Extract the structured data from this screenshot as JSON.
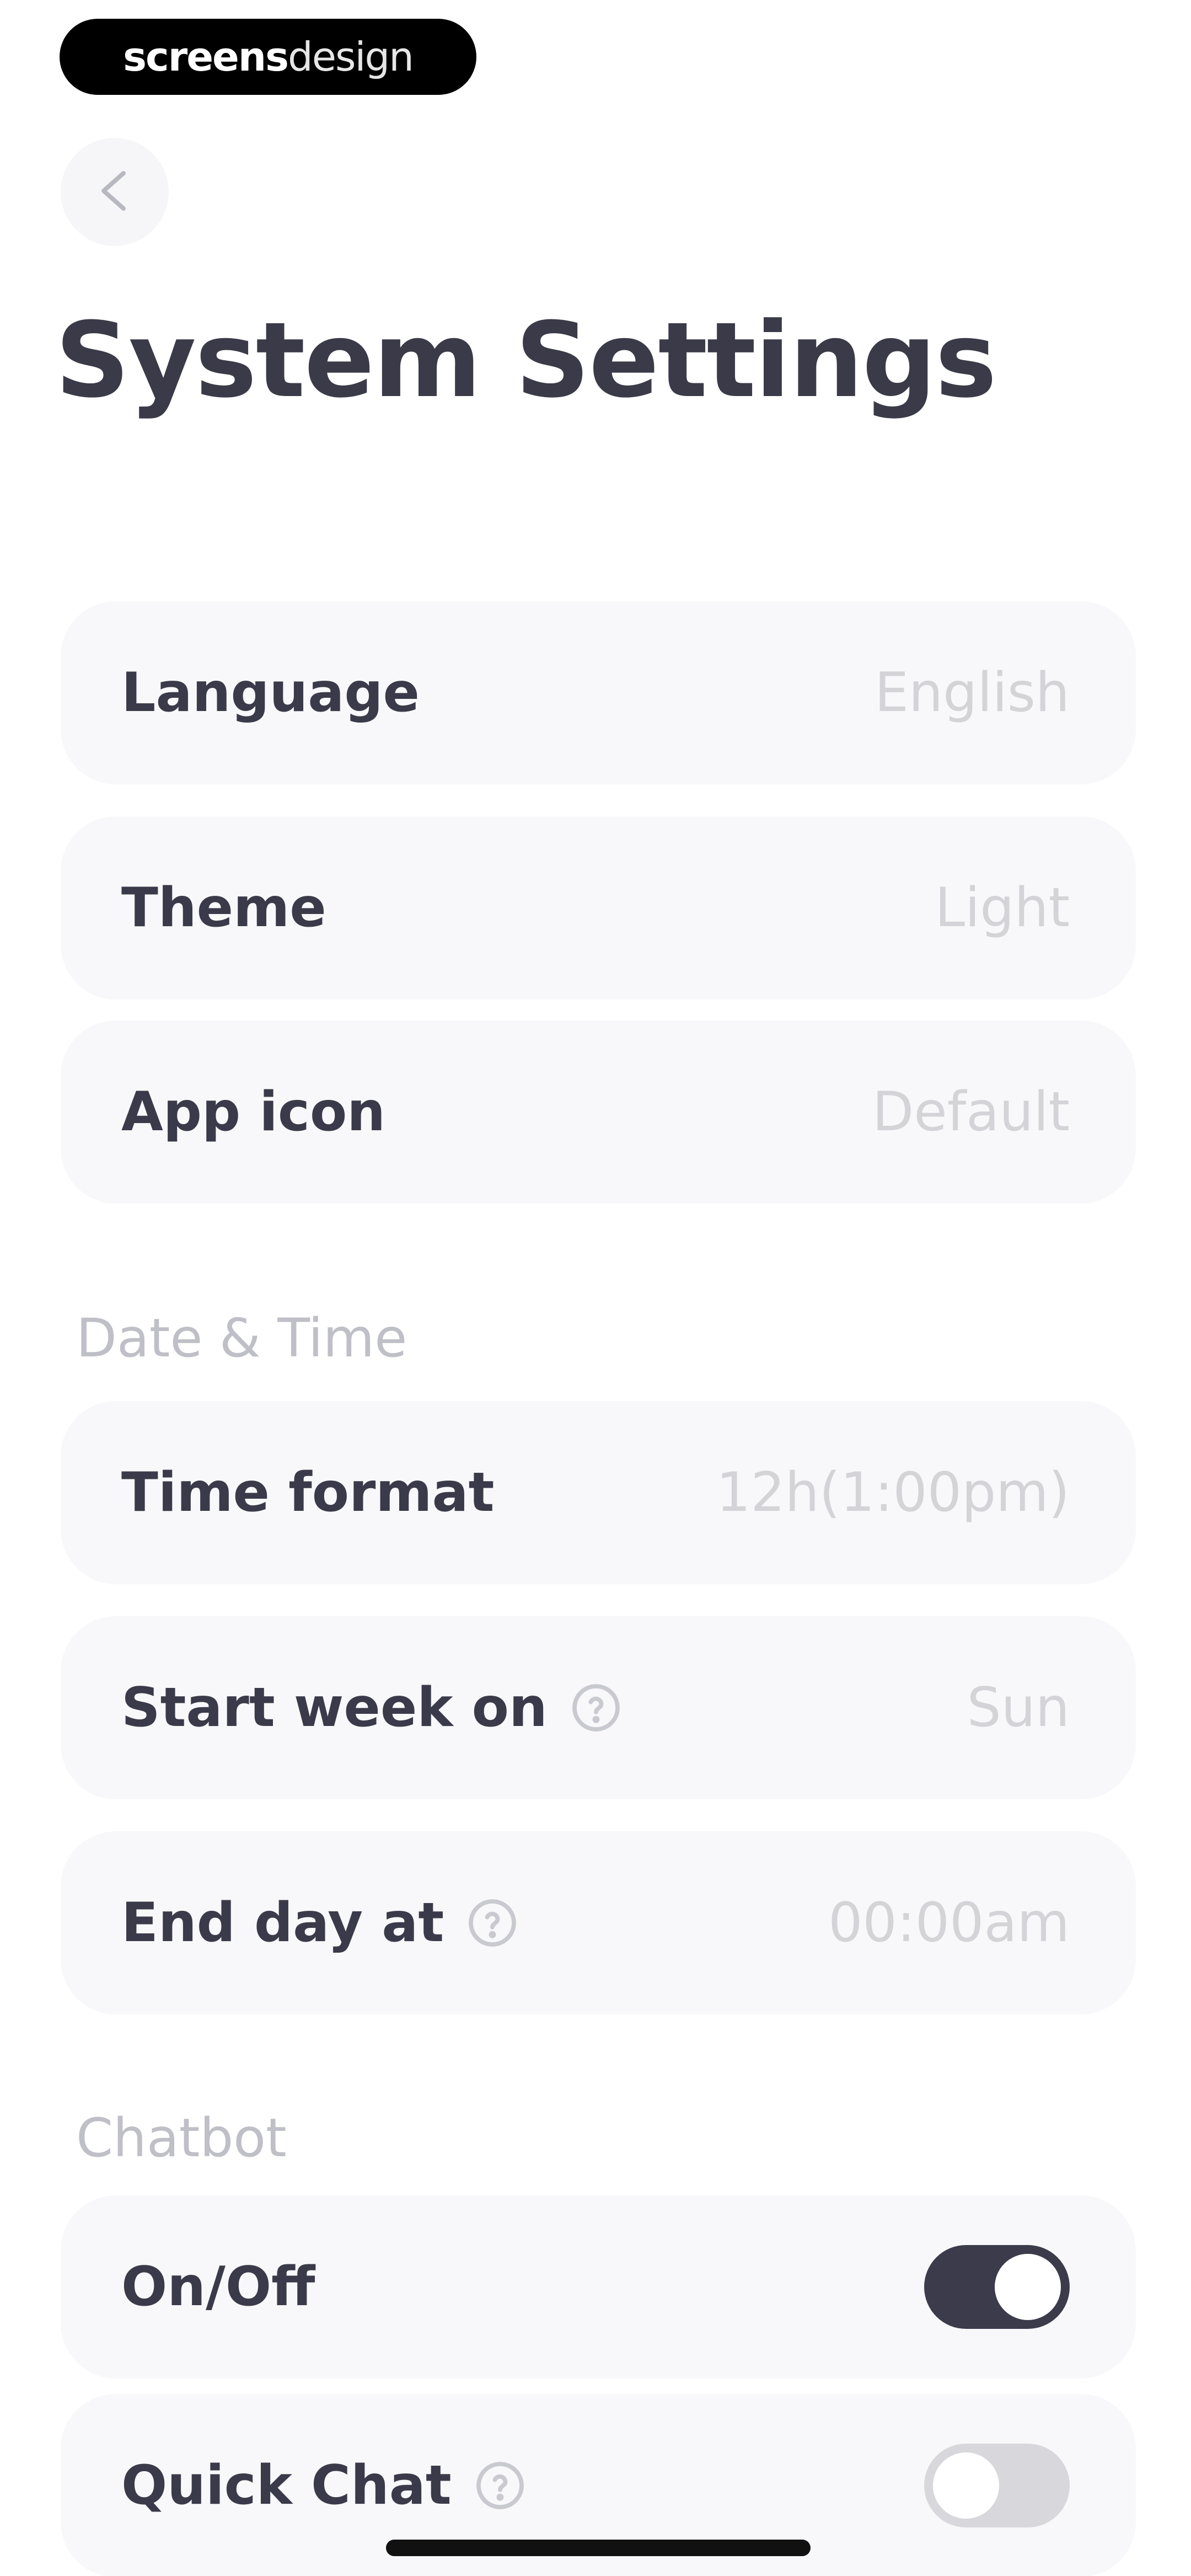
{
  "brand": {
    "part1": "screens",
    "part2": "design"
  },
  "page_title": "System Settings",
  "general": [
    {
      "label": "Language",
      "value": "English"
    },
    {
      "label": "Theme",
      "value": "Light"
    },
    {
      "label": "App icon",
      "value": "Default"
    }
  ],
  "date_time": {
    "section_label": "Date & Time",
    "items": [
      {
        "label": "Time format",
        "value": "12h(1:00pm)"
      },
      {
        "label": "Start week on",
        "value": "Sun"
      },
      {
        "label": "End day at",
        "value": "00:00am"
      }
    ]
  },
  "chatbot": {
    "section_label": "Chatbot",
    "items": [
      {
        "label": "On/Off",
        "toggle": "on"
      },
      {
        "label": "Quick Chat",
        "toggle": "off"
      }
    ]
  },
  "colors": {
    "toggle_on": "#3b3b4b",
    "toggle_off": "#d8d8dc",
    "row_bg": "#f8f8fa",
    "text_primary": "#3a3a4a",
    "text_muted": "#bfbfc7"
  },
  "icons": {
    "back": "chevron-left-icon",
    "help": "question-circle-icon"
  }
}
